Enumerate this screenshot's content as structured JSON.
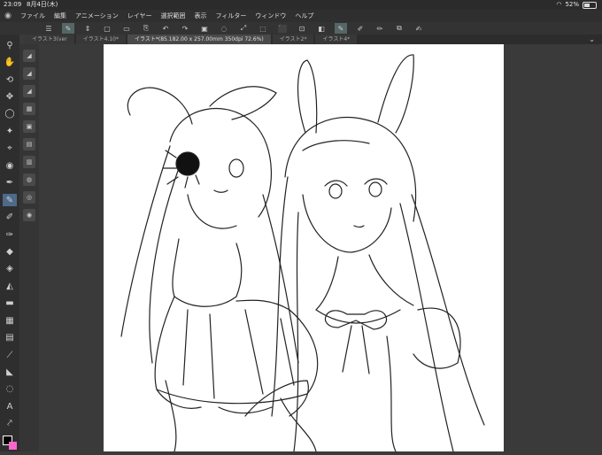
{
  "status": {
    "time": "23:09",
    "date": "8月4日(木)",
    "battery": "52%"
  },
  "menu": [
    "ファイル",
    "編集",
    "アニメーション",
    "レイヤー",
    "選択範囲",
    "表示",
    "フィルター",
    "ウィンドウ",
    "ヘルプ"
  ],
  "tabs": [
    {
      "label": "イラスト3(ver"
    },
    {
      "label": "イラスト4.10*"
    },
    {
      "label": "イラスト*(85.182.00 x 257.00mm 350dpi 72.6%)"
    },
    {
      "label": "イラスト2*"
    },
    {
      "label": "イラスト4*"
    }
  ],
  "colors": {
    "main": "#000000",
    "sub": "#ff66cc"
  }
}
